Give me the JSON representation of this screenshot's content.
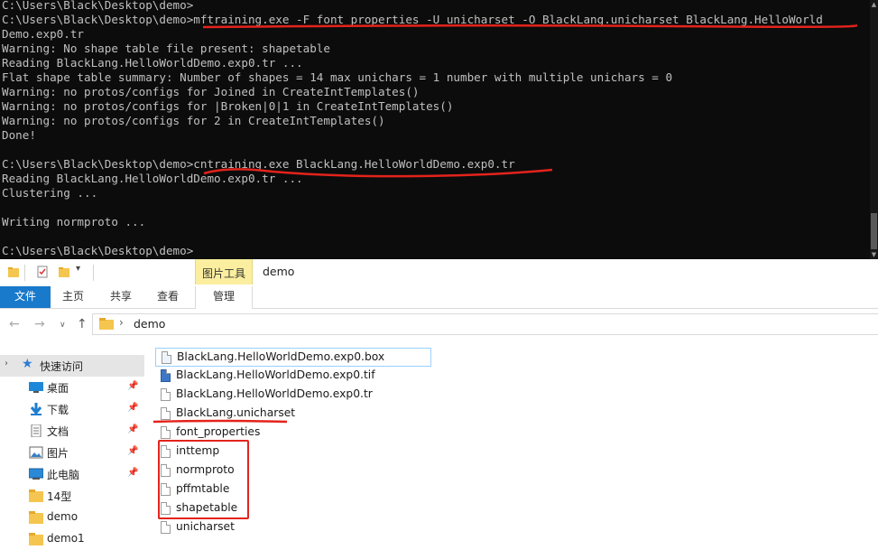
{
  "console": {
    "lines": [
      "C:\\Users\\Black\\Desktop\\demo>",
      "C:\\Users\\Black\\Desktop\\demo>mftraining.exe -F font_properties -U unicharset -O BlackLang.unicharset BlackLang.HelloWorld",
      "Demo.exp0.tr",
      "Warning: No shape table file present: shapetable",
      "Reading BlackLang.HelloWorldDemo.exp0.tr ...",
      "Flat shape table summary: Number of shapes = 14 max unichars = 1 number with multiple unichars = 0",
      "Warning: no protos/configs for Joined in CreateIntTemplates()",
      "Warning: no protos/configs for |Broken|0|1 in CreateIntTemplates()",
      "Warning: no protos/configs for 2 in CreateIntTemplates()",
      "Done!",
      "",
      "C:\\Users\\Black\\Desktop\\demo>cntraining.exe BlackLang.HelloWorldDemo.exp0.tr",
      "Reading BlackLang.HelloWorldDemo.exp0.tr ...",
      "Clustering ...",
      "",
      "Writing normproto ...",
      "",
      "C:\\Users\\Black\\Desktop\\demo>"
    ]
  },
  "explorer": {
    "context_tab_group": "图片工具",
    "window_title": "demo",
    "ribbon_tabs": [
      "文件",
      "主页",
      "共享",
      "查看",
      "管理"
    ],
    "address": {
      "path": "demo"
    },
    "nav": {
      "quick_access": "快速访问",
      "items": [
        {
          "label": "桌面",
          "pinned": true
        },
        {
          "label": "下载",
          "pinned": true
        },
        {
          "label": "文档",
          "pinned": true
        },
        {
          "label": "图片",
          "pinned": true
        },
        {
          "label": "此电脑",
          "pinned": true
        },
        {
          "label": "14型",
          "pinned": false
        },
        {
          "label": "demo",
          "pinned": false
        },
        {
          "label": "demo1",
          "pinned": false
        }
      ]
    },
    "files": [
      {
        "name": "BlackLang.HelloWorldDemo.exp0.box",
        "icon": "box-file-icon"
      },
      {
        "name": "BlackLang.HelloWorldDemo.exp0.tif",
        "icon": "tif-file-icon"
      },
      {
        "name": "BlackLang.HelloWorldDemo.exp0.tr",
        "icon": "file-icon"
      },
      {
        "name": "BlackLang.unicharset",
        "icon": "file-icon"
      },
      {
        "name": "font_properties",
        "icon": "file-icon"
      },
      {
        "name": "inttemp",
        "icon": "file-icon"
      },
      {
        "name": "normproto",
        "icon": "file-icon"
      },
      {
        "name": "pffmtable",
        "icon": "file-icon"
      },
      {
        "name": "shapetable",
        "icon": "file-icon"
      },
      {
        "name": "unicharset",
        "icon": "file-icon"
      }
    ]
  },
  "colors": {
    "annotation_red": "#e3231c",
    "file_tab_blue": "#1979ca",
    "context_yellow": "#fbee9f"
  }
}
